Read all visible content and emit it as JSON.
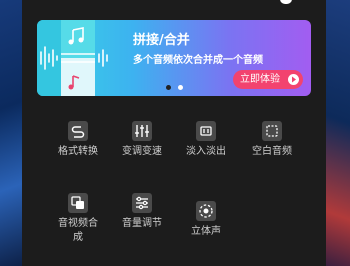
{
  "banner": {
    "title": "拼接/合并",
    "subtitle": "多个音频依次合并成一个音频",
    "cta_label": "立即体验",
    "accent_start": "#37d6e3",
    "accent_end": "#a25df1",
    "cta_color": "#f2436f",
    "pager_active_index": 1,
    "pager_count": 2
  },
  "tools": [
    {
      "label": "格式转换",
      "icon": "format-convert-icon"
    },
    {
      "label": "变调变速",
      "icon": "pitch-speed-sliders-icon"
    },
    {
      "label": "淡入淡出",
      "icon": "fade-in-out-icon"
    },
    {
      "label": "空白音频",
      "icon": "blank-audio-icon"
    },
    {
      "label": "音视频合成",
      "icon": "av-merge-icon"
    },
    {
      "label": "音量调节",
      "icon": "volume-adjust-icon"
    },
    {
      "label": "立体声",
      "icon": "stereo-icon"
    }
  ],
  "colors": {
    "panel_bg": "#1c1c1c",
    "icon_bg": "#4a4a4a",
    "label_text": "#cfcfcf"
  }
}
